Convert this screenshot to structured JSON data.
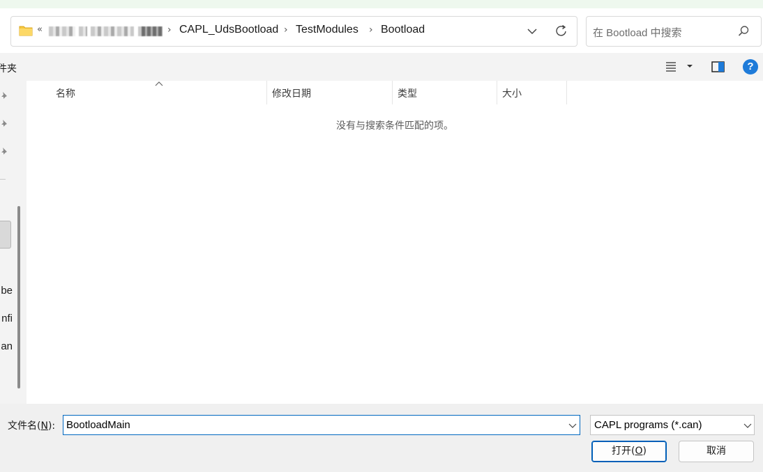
{
  "address_bar": {
    "overflow": "«",
    "breadcrumbs": [
      "CAPL_UdsBootload",
      "TestModules",
      "Bootload"
    ],
    "separator": "›"
  },
  "search": {
    "placeholder": "在 Bootload 中搜索"
  },
  "toolbar": {
    "left_label_fragment": "件夹",
    "help": "?"
  },
  "nav_pane": {
    "items": [
      "be",
      "nfi",
      "an"
    ]
  },
  "file_list": {
    "columns": [
      "名称",
      "修改日期",
      "类型",
      "大小"
    ],
    "empty_message": "没有与搜索条件匹配的项。"
  },
  "bottom": {
    "filename_label_prefix": "文件名(",
    "filename_label_hotkey": "N",
    "filename_label_suffix": "):",
    "filename_value": "BootloadMain",
    "filetype_value": "CAPL programs (*.can)",
    "open_prefix": "打开(",
    "open_hotkey": "O",
    "open_suffix": ")",
    "cancel_label": "取消"
  },
  "colors": {
    "accent": "#0067c0",
    "help_blue": "#1e7bd9",
    "folder_yellow": "#f8c93e"
  }
}
